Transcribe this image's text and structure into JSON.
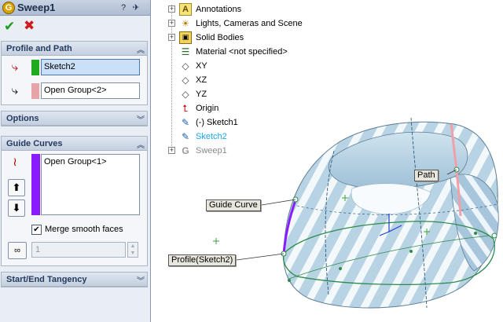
{
  "property_manager": {
    "title": "Sweep1",
    "help_label": "?",
    "pin_label": "✈",
    "ok_label": "✔",
    "cancel_label": "✖",
    "profile_group": {
      "title": "Profile and Path",
      "profile_value": "Sketch2",
      "path_value": "Open Group<2>",
      "profile_color": "#1faa1f",
      "path_color": "#e8a3a8"
    },
    "options_group": {
      "title": "Options"
    },
    "guide_curves_group": {
      "title": "Guide Curves",
      "items": [
        "Open Group<1>"
      ],
      "swatch_color": "#8a1bff",
      "up_label": "⬆",
      "down_label": "⬇",
      "merge_label": "Merge smooth faces",
      "merge_checked": "✔",
      "spin_value": "1"
    },
    "tangency_group": {
      "title": "Start/End Tangency"
    }
  },
  "feature_tree": {
    "items": [
      {
        "label": "Annotations",
        "icon": "annotations-icon",
        "expander": "+",
        "style": ""
      },
      {
        "label": "Lights, Cameras and Scene",
        "icon": "lights-icon",
        "expander": "+",
        "style": ""
      },
      {
        "label": "Solid Bodies",
        "icon": "solid-bodies-icon",
        "expander": "+",
        "style": ""
      },
      {
        "label": "Material <not specified>",
        "icon": "material-icon",
        "expander": "",
        "style": ""
      },
      {
        "label": "XY",
        "icon": "plane-icon",
        "expander": "",
        "style": ""
      },
      {
        "label": "XZ",
        "icon": "plane-icon",
        "expander": "",
        "style": ""
      },
      {
        "label": "YZ",
        "icon": "plane-icon",
        "expander": "",
        "style": ""
      },
      {
        "label": "Origin",
        "icon": "origin-icon",
        "expander": "",
        "style": ""
      },
      {
        "label": "(-) Sketch1",
        "icon": "sketch-icon",
        "expander": "",
        "style": ""
      },
      {
        "label": "Sketch2",
        "icon": "sketch-icon",
        "expander": "",
        "style": "active"
      },
      {
        "label": "Sweep1",
        "icon": "sweep-icon",
        "expander": "+",
        "style": "dim"
      }
    ]
  },
  "viewport": {
    "callouts": {
      "path": "Path",
      "guide_curve": "Guide Curve",
      "profile": "Profile(Sketch2)"
    },
    "colors": {
      "surface": "#b8d3e4",
      "stripe": "#ffffff",
      "guide": "#8a1bff",
      "path": "#f0a0a8",
      "profile": "#2c8a4a"
    }
  }
}
